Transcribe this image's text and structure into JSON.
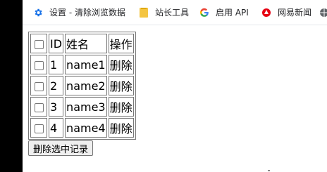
{
  "bookmarks_bar": {
    "items": [
      {
        "label": "设置 - 清除浏览数据",
        "icon": "gear-icon",
        "color": "#1a73e8"
      },
      {
        "label": "站长工具",
        "icon": "folder-icon",
        "color": "#f4c542"
      },
      {
        "label": "启用 API",
        "icon": "google-g-icon",
        "color": "#ea4335"
      },
      {
        "label": "网易新闻",
        "icon": "netease-icon",
        "color": "#e60012"
      }
    ]
  },
  "table": {
    "headers": {
      "id": "ID",
      "name": "姓名",
      "action": "操作"
    },
    "rows": [
      {
        "id": "1",
        "name": "name1",
        "action": "删除"
      },
      {
        "id": "2",
        "name": "name2",
        "action": "删除"
      },
      {
        "id": "3",
        "name": "name3",
        "action": "删除"
      },
      {
        "id": "4",
        "name": "name4",
        "action": "删除"
      }
    ]
  },
  "actions": {
    "delete_selected_label": "删除选中记录"
  }
}
